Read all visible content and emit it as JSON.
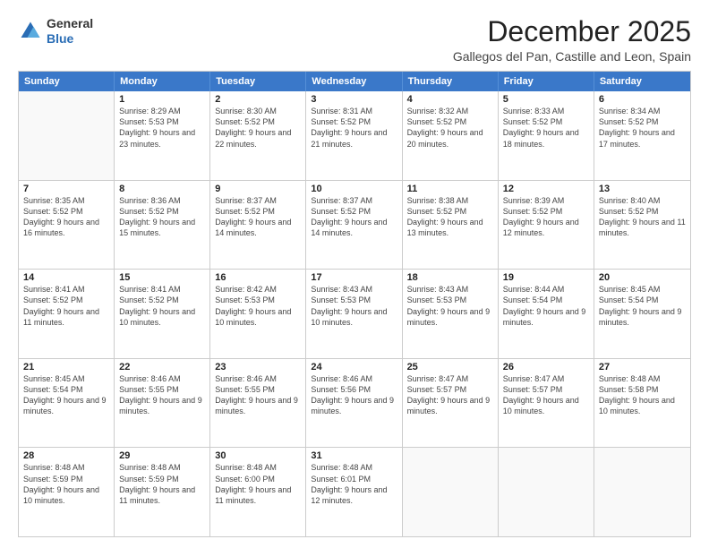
{
  "header": {
    "logo": {
      "general": "General",
      "blue": "Blue"
    },
    "month": "December 2025",
    "location": "Gallegos del Pan, Castille and Leon, Spain"
  },
  "weekdays": [
    "Sunday",
    "Monday",
    "Tuesday",
    "Wednesday",
    "Thursday",
    "Friday",
    "Saturday"
  ],
  "weeks": [
    [
      {
        "day": "",
        "empty": true
      },
      {
        "day": "1",
        "sunrise": "Sunrise: 8:29 AM",
        "sunset": "Sunset: 5:53 PM",
        "daylight": "Daylight: 9 hours and 23 minutes."
      },
      {
        "day": "2",
        "sunrise": "Sunrise: 8:30 AM",
        "sunset": "Sunset: 5:52 PM",
        "daylight": "Daylight: 9 hours and 22 minutes."
      },
      {
        "day": "3",
        "sunrise": "Sunrise: 8:31 AM",
        "sunset": "Sunset: 5:52 PM",
        "daylight": "Daylight: 9 hours and 21 minutes."
      },
      {
        "day": "4",
        "sunrise": "Sunrise: 8:32 AM",
        "sunset": "Sunset: 5:52 PM",
        "daylight": "Daylight: 9 hours and 20 minutes."
      },
      {
        "day": "5",
        "sunrise": "Sunrise: 8:33 AM",
        "sunset": "Sunset: 5:52 PM",
        "daylight": "Daylight: 9 hours and 18 minutes."
      },
      {
        "day": "6",
        "sunrise": "Sunrise: 8:34 AM",
        "sunset": "Sunset: 5:52 PM",
        "daylight": "Daylight: 9 hours and 17 minutes."
      }
    ],
    [
      {
        "day": "7",
        "sunrise": "Sunrise: 8:35 AM",
        "sunset": "Sunset: 5:52 PM",
        "daylight": "Daylight: 9 hours and 16 minutes."
      },
      {
        "day": "8",
        "sunrise": "Sunrise: 8:36 AM",
        "sunset": "Sunset: 5:52 PM",
        "daylight": "Daylight: 9 hours and 15 minutes."
      },
      {
        "day": "9",
        "sunrise": "Sunrise: 8:37 AM",
        "sunset": "Sunset: 5:52 PM",
        "daylight": "Daylight: 9 hours and 14 minutes."
      },
      {
        "day": "10",
        "sunrise": "Sunrise: 8:37 AM",
        "sunset": "Sunset: 5:52 PM",
        "daylight": "Daylight: 9 hours and 14 minutes."
      },
      {
        "day": "11",
        "sunrise": "Sunrise: 8:38 AM",
        "sunset": "Sunset: 5:52 PM",
        "daylight": "Daylight: 9 hours and 13 minutes."
      },
      {
        "day": "12",
        "sunrise": "Sunrise: 8:39 AM",
        "sunset": "Sunset: 5:52 PM",
        "daylight": "Daylight: 9 hours and 12 minutes."
      },
      {
        "day": "13",
        "sunrise": "Sunrise: 8:40 AM",
        "sunset": "Sunset: 5:52 PM",
        "daylight": "Daylight: 9 hours and 11 minutes."
      }
    ],
    [
      {
        "day": "14",
        "sunrise": "Sunrise: 8:41 AM",
        "sunset": "Sunset: 5:52 PM",
        "daylight": "Daylight: 9 hours and 11 minutes."
      },
      {
        "day": "15",
        "sunrise": "Sunrise: 8:41 AM",
        "sunset": "Sunset: 5:52 PM",
        "daylight": "Daylight: 9 hours and 10 minutes."
      },
      {
        "day": "16",
        "sunrise": "Sunrise: 8:42 AM",
        "sunset": "Sunset: 5:53 PM",
        "daylight": "Daylight: 9 hours and 10 minutes."
      },
      {
        "day": "17",
        "sunrise": "Sunrise: 8:43 AM",
        "sunset": "Sunset: 5:53 PM",
        "daylight": "Daylight: 9 hours and 10 minutes."
      },
      {
        "day": "18",
        "sunrise": "Sunrise: 8:43 AM",
        "sunset": "Sunset: 5:53 PM",
        "daylight": "Daylight: 9 hours and 9 minutes."
      },
      {
        "day": "19",
        "sunrise": "Sunrise: 8:44 AM",
        "sunset": "Sunset: 5:54 PM",
        "daylight": "Daylight: 9 hours and 9 minutes."
      },
      {
        "day": "20",
        "sunrise": "Sunrise: 8:45 AM",
        "sunset": "Sunset: 5:54 PM",
        "daylight": "Daylight: 9 hours and 9 minutes."
      }
    ],
    [
      {
        "day": "21",
        "sunrise": "Sunrise: 8:45 AM",
        "sunset": "Sunset: 5:54 PM",
        "daylight": "Daylight: 9 hours and 9 minutes."
      },
      {
        "day": "22",
        "sunrise": "Sunrise: 8:46 AM",
        "sunset": "Sunset: 5:55 PM",
        "daylight": "Daylight: 9 hours and 9 minutes."
      },
      {
        "day": "23",
        "sunrise": "Sunrise: 8:46 AM",
        "sunset": "Sunset: 5:55 PM",
        "daylight": "Daylight: 9 hours and 9 minutes."
      },
      {
        "day": "24",
        "sunrise": "Sunrise: 8:46 AM",
        "sunset": "Sunset: 5:56 PM",
        "daylight": "Daylight: 9 hours and 9 minutes."
      },
      {
        "day": "25",
        "sunrise": "Sunrise: 8:47 AM",
        "sunset": "Sunset: 5:57 PM",
        "daylight": "Daylight: 9 hours and 9 minutes."
      },
      {
        "day": "26",
        "sunrise": "Sunrise: 8:47 AM",
        "sunset": "Sunset: 5:57 PM",
        "daylight": "Daylight: 9 hours and 10 minutes."
      },
      {
        "day": "27",
        "sunrise": "Sunrise: 8:48 AM",
        "sunset": "Sunset: 5:58 PM",
        "daylight": "Daylight: 9 hours and 10 minutes."
      }
    ],
    [
      {
        "day": "28",
        "sunrise": "Sunrise: 8:48 AM",
        "sunset": "Sunset: 5:59 PM",
        "daylight": "Daylight: 9 hours and 10 minutes."
      },
      {
        "day": "29",
        "sunrise": "Sunrise: 8:48 AM",
        "sunset": "Sunset: 5:59 PM",
        "daylight": "Daylight: 9 hours and 11 minutes."
      },
      {
        "day": "30",
        "sunrise": "Sunrise: 8:48 AM",
        "sunset": "Sunset: 6:00 PM",
        "daylight": "Daylight: 9 hours and 11 minutes."
      },
      {
        "day": "31",
        "sunrise": "Sunrise: 8:48 AM",
        "sunset": "Sunset: 6:01 PM",
        "daylight": "Daylight: 9 hours and 12 minutes."
      },
      {
        "day": "",
        "empty": true
      },
      {
        "day": "",
        "empty": true
      },
      {
        "day": "",
        "empty": true
      }
    ]
  ]
}
